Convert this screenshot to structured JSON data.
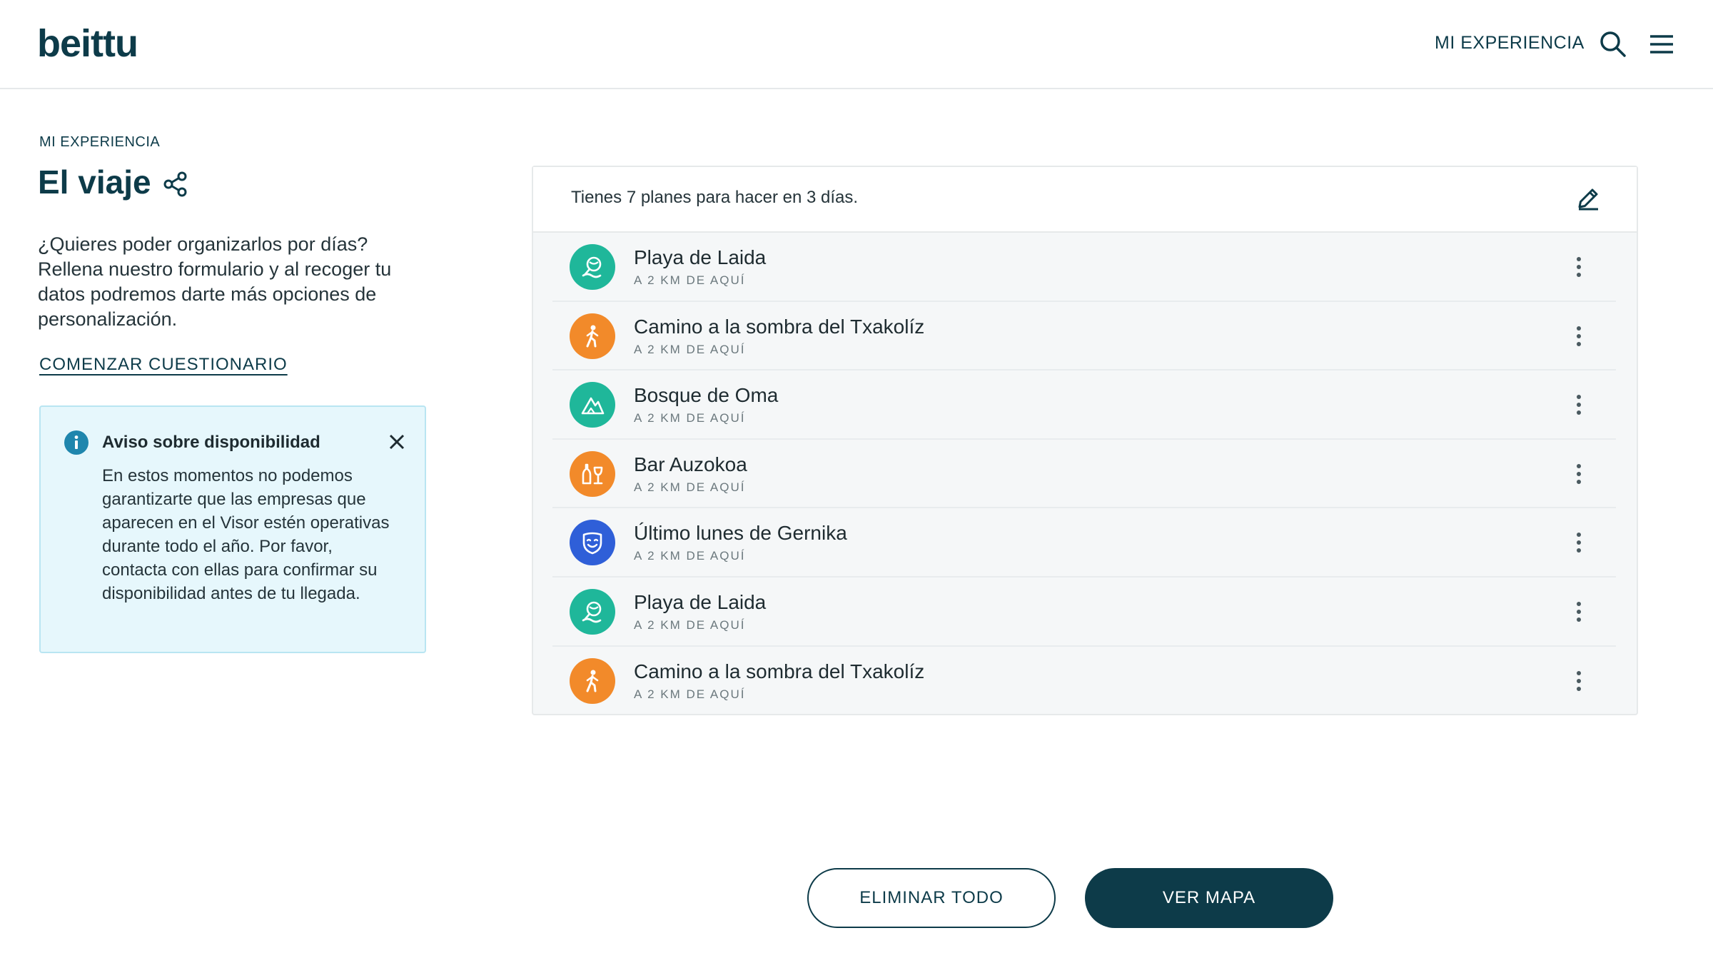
{
  "header": {
    "logo": "beittu",
    "nav_link": "MI EXPERIENCIA"
  },
  "main": {
    "breadcrumb": "MI EXPERIENCIA",
    "title": "El viaje",
    "intro": "¿Quieres poder organizarlos por días? Rellena nuestro formulario y al recoger tu datos podremos darte más opciones de personalización.",
    "cta": "COMENZAR CUESTIONARIO",
    "notice": {
      "title": "Aviso sobre disponibilidad",
      "body": "En estos momentos no podemos garantizarte que las empresas que aparecen en el Visor estén operativas durante todo el año. Por favor, contacta con ellas para confirmar su disponibilidad antes de tu llegada."
    }
  },
  "card": {
    "summary": "Tienes 7 planes para hacer en 3 días.",
    "plans": [
      {
        "name": "Playa de Laida",
        "distance": "A 2 KM DE AQUÍ",
        "icon": "beach-icon",
        "color": "#1fb79a"
      },
      {
        "name": "Camino a la sombra del Txakolíz",
        "distance": "A 2 KM DE AQUÍ",
        "icon": "hiking-icon",
        "color": "#f28a2a"
      },
      {
        "name": "Bosque de Oma",
        "distance": "A 2 KM DE AQUÍ",
        "icon": "mountain-icon",
        "color": "#1fb79a"
      },
      {
        "name": "Bar Auzokoa",
        "distance": "A 2 KM DE AQUÍ",
        "icon": "drinks-icon",
        "color": "#f28a2a"
      },
      {
        "name": "Último lunes de Gernika",
        "distance": "A 2 KM DE AQUÍ",
        "icon": "mask-icon",
        "color": "#2f5fd8"
      },
      {
        "name": "Playa de Laida",
        "distance": "A 2 KM DE AQUÍ",
        "icon": "beach-icon",
        "color": "#1fb79a"
      },
      {
        "name": "Camino a la sombra del Txakolíz",
        "distance": "A 2 KM DE AQUÍ",
        "icon": "hiking-icon",
        "color": "#f28a2a"
      }
    ]
  },
  "actions": {
    "delete_all": "ELIMINAR TODO",
    "view_map": "VER MAPA"
  }
}
